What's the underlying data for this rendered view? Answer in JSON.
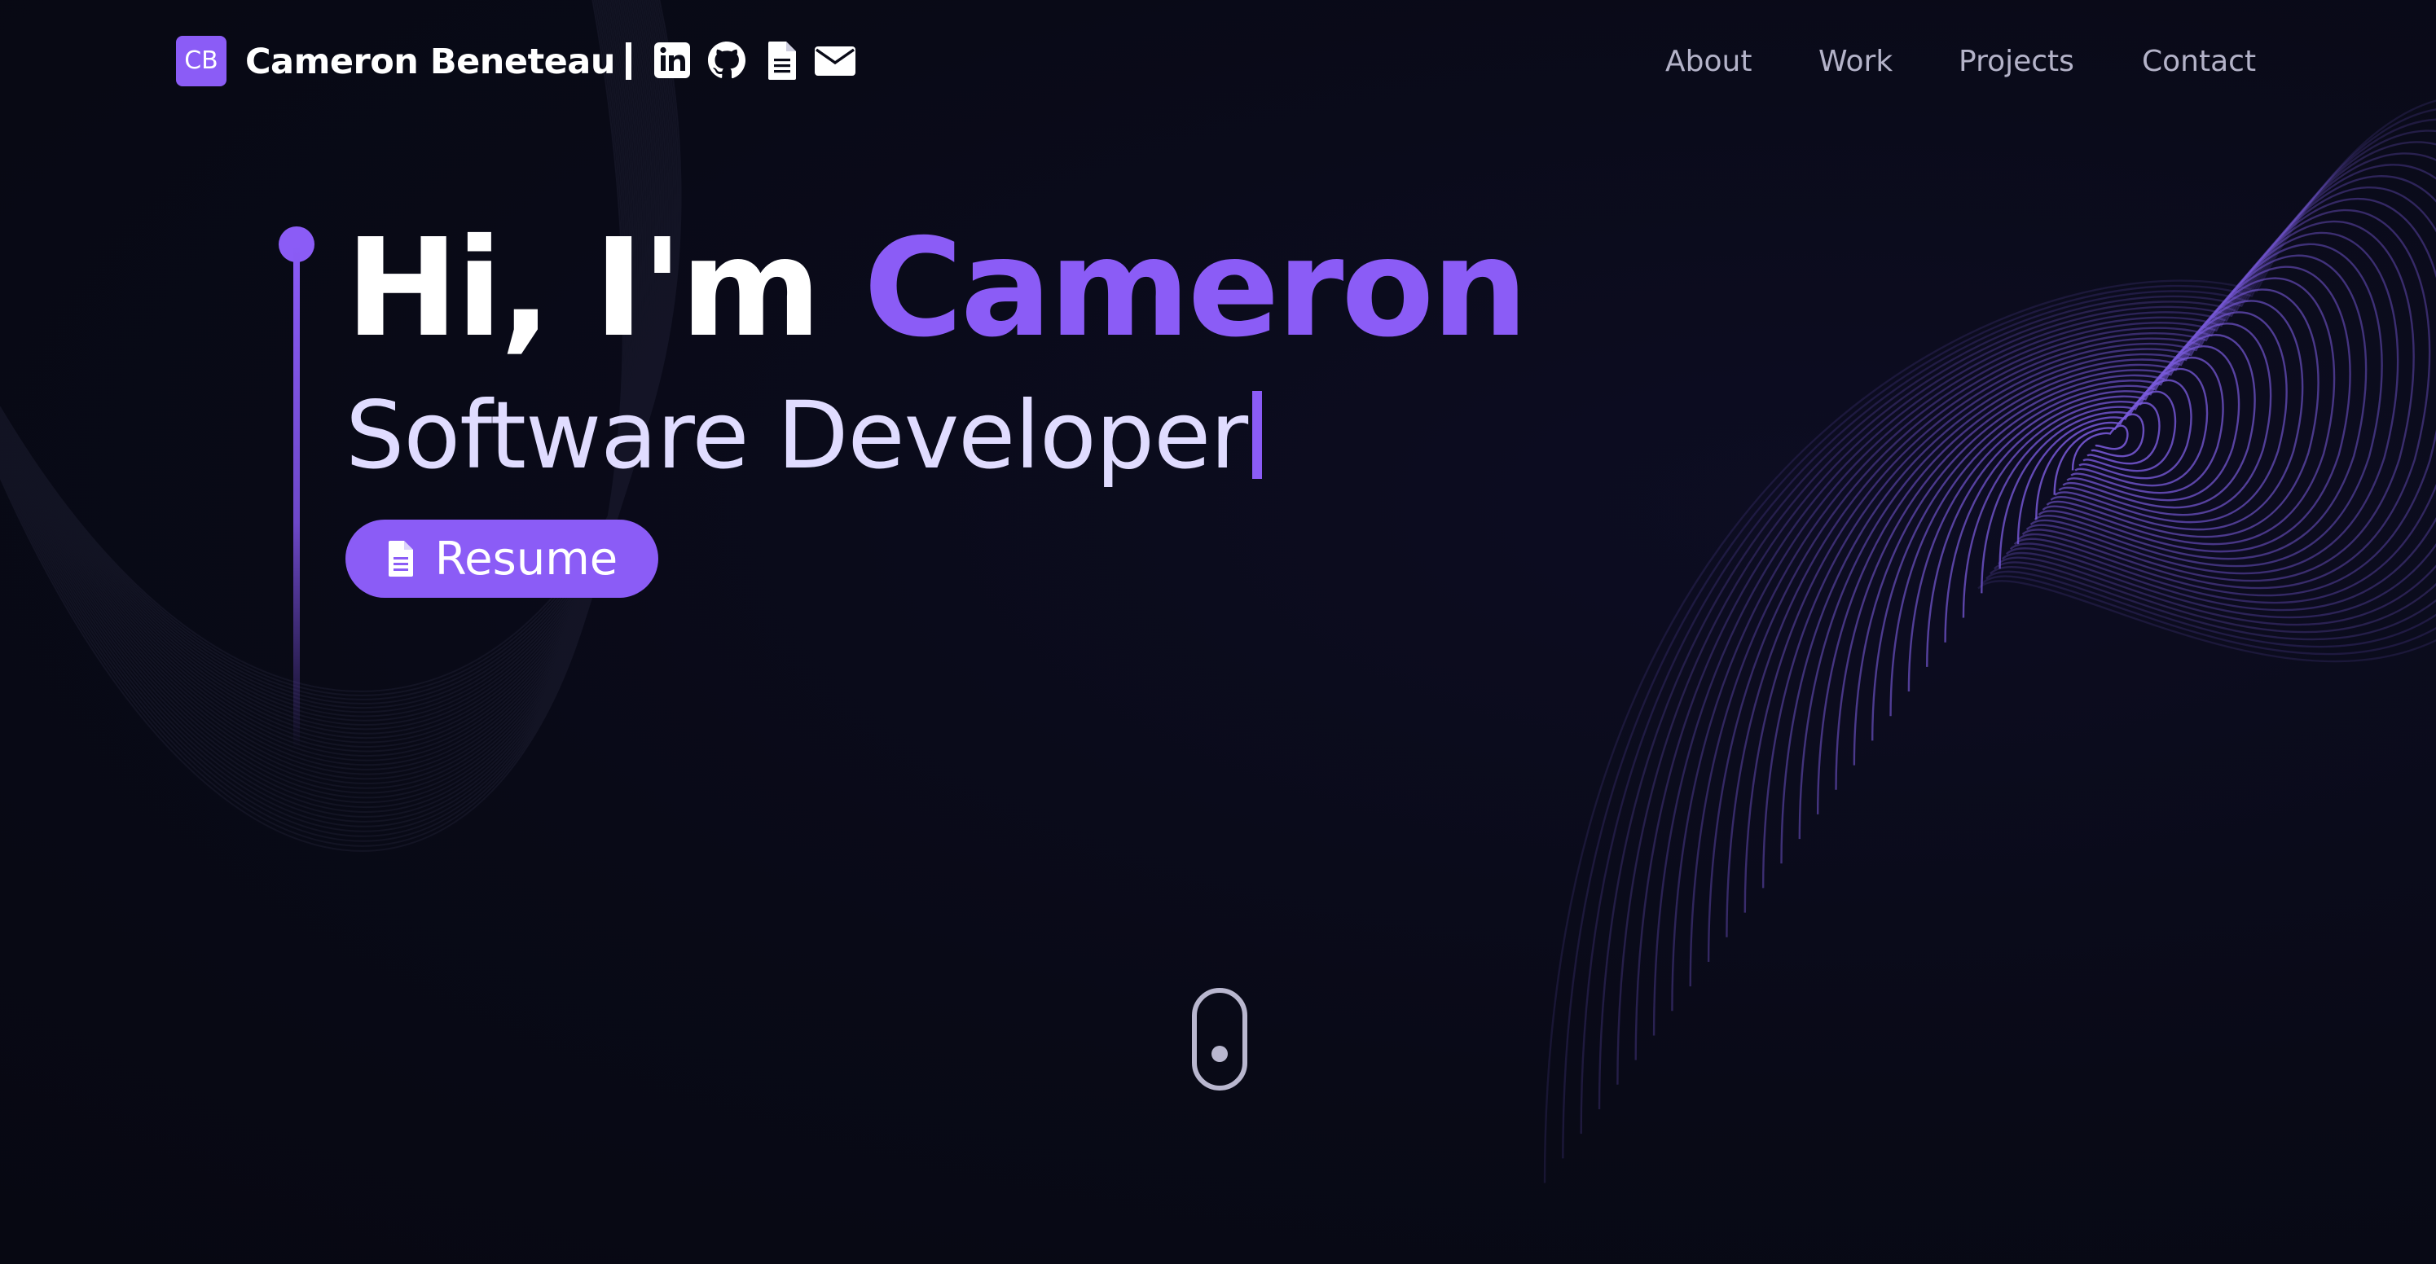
{
  "header": {
    "logo_badge": "CB",
    "brand_name": "Cameron Beneteau",
    "social_icons": [
      "linkedin-icon",
      "github-icon",
      "document-icon",
      "envelope-icon"
    ]
  },
  "nav": {
    "items": [
      {
        "label": "About"
      },
      {
        "label": "Work"
      },
      {
        "label": "Projects"
      },
      {
        "label": "Contact"
      }
    ]
  },
  "hero": {
    "greeting": "Hi, I'm",
    "name": "Cameron",
    "subtitle": "Software Developer",
    "resume_label": "Resume",
    "resume_icon": "document-icon"
  },
  "scroll_indicator": {
    "icon": "mouse-scroll-icon"
  },
  "colors": {
    "background": "#090a17",
    "accent": "#8b5cf6",
    "nav_text": "#b4b3c9",
    "subtitle_text": "#e0dcff",
    "white": "#ffffff"
  }
}
